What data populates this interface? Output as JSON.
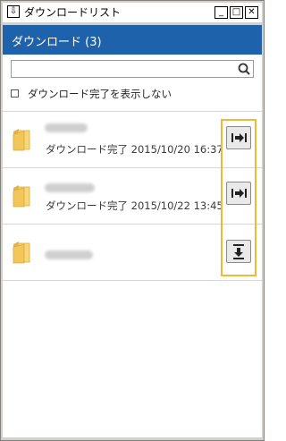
{
  "window": {
    "title": "ダウンロードリスト",
    "controls": {
      "minimize": "_",
      "maximize": "□",
      "close": "✕"
    }
  },
  "header": {
    "title": "ダウンロード (3)"
  },
  "search": {
    "value": "",
    "placeholder": ""
  },
  "filter": {
    "hide_completed_label": "ダウンロード完了を表示しない",
    "checked": false
  },
  "downloads": [
    {
      "name_blurred": true,
      "status": "ダウンロード完了 2015/10/20 16:37",
      "action": "open-icon"
    },
    {
      "name_blurred": true,
      "status": "ダウンロード完了 2015/10/22 13:45",
      "action": "open-icon"
    },
    {
      "name_blurred": true,
      "status": "",
      "action": "download-icon"
    }
  ],
  "colors": {
    "header": "#1f62ac",
    "highlight": "#f1b933",
    "window": "#d4d0c8"
  }
}
